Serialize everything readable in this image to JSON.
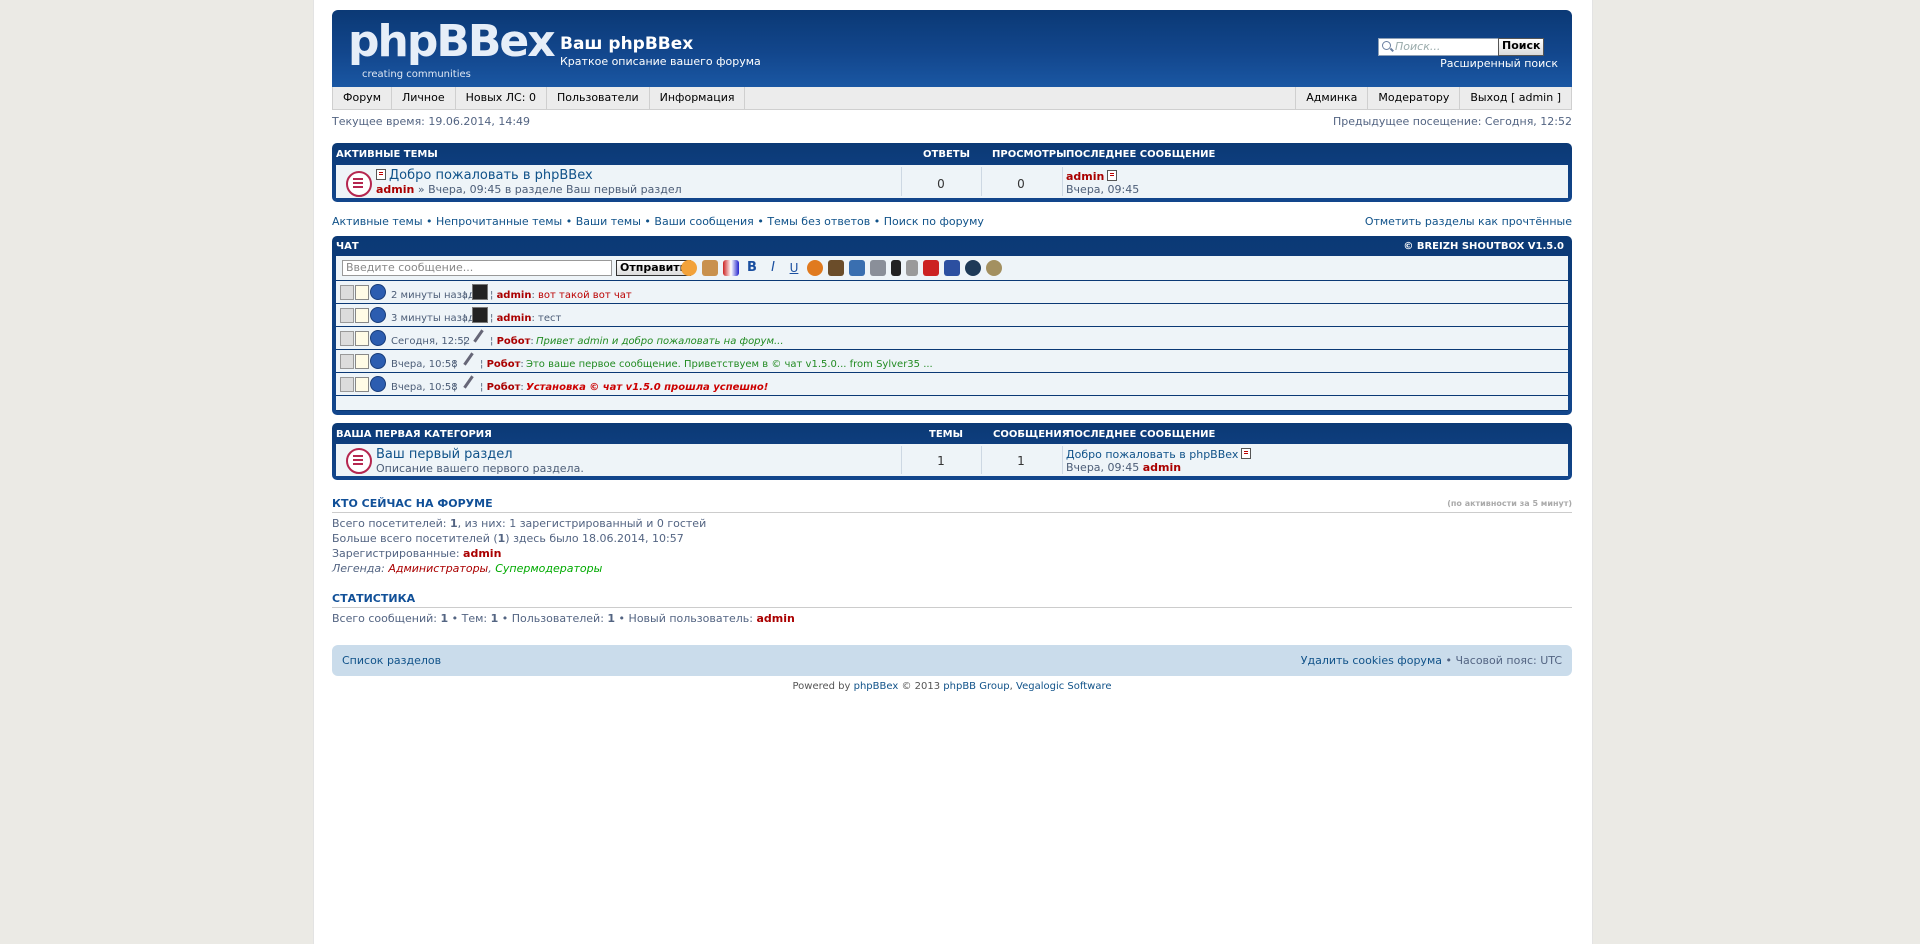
{
  "header": {
    "logo_text": "phpBBex",
    "logo_tagline": "creating communities",
    "site_title": "Ваш phpBBex",
    "site_description": "Краткое описание вашего форума",
    "search_placeholder": "Поиск...",
    "search_button": "Поиск",
    "advanced_search": "Расширенный поиск",
    "brand_color": "#12468c"
  },
  "navbar": {
    "left": [
      "Форум",
      "Личное",
      "Новых ЛС: 0",
      "Пользователи",
      "Информация"
    ],
    "right": [
      "Админка",
      "Модератору",
      "Выход [ admin ]"
    ]
  },
  "timebar": {
    "current_time": "Текущее время: 19.06.2014, 14:49",
    "last_visit": "Предыдущее посещение: Сегодня, 12:52"
  },
  "active_topics": {
    "title": "АКТИВНЫЕ ТЕМЫ",
    "col_replies": "ОТВЕТЫ",
    "col_views": "ПРОСМОТРЫ",
    "col_last": "ПОСЛЕДНЕЕ СООБЩЕНИЕ",
    "topic": {
      "title": "Добро пожаловать в phpBBex",
      "author": "admin",
      "meta": " » Вчера, 09:45 в разделе Ваш первый раздел",
      "replies": "0",
      "views": "0",
      "last_author": "admin",
      "last_time": "Вчера, 09:45"
    }
  },
  "quick_links": {
    "left": [
      "Активные темы",
      "Непрочитанные темы",
      "Ваши темы",
      "Ваши сообщения",
      "Темы без ответов",
      "Поиск по форуму"
    ],
    "right": "Отметить разделы как прочтённые"
  },
  "chat": {
    "title": "ЧАТ",
    "credit": "© BREIZH SHOUTBOX V1.5.0",
    "input_placeholder": "Введите сообщение...",
    "send_button": "Отправить",
    "messages": [
      {
        "time": "2 минуты назад",
        "user": "admin",
        "text": "вот такой вот чат"
      },
      {
        "time": "3 минуты назад",
        "user": "admin",
        "text": "тест"
      },
      {
        "time": "Сегодня, 12:52",
        "user": "Робот",
        "text": "Привет admin и добро пожаловать на форум..."
      },
      {
        "time": "Вчера, 10:58",
        "user": "Робот",
        "text": "Это ваше первое сообщение. Приветствуем в © чат v1.5.0... from Sylver35 ..."
      },
      {
        "time": "Вчера, 10:58",
        "user": "Робот",
        "text": "Установка © чат v1.5.0 прошла успешно!"
      }
    ]
  },
  "category": {
    "title": "ВАША ПЕРВАЯ КАТЕГОРИЯ",
    "col_topics": "ТЕМЫ",
    "col_posts": "СООБЩЕНИЯ",
    "col_last": "ПОСЛЕДНЕЕ СООБЩЕНИЕ",
    "forum": {
      "title": "Ваш первый раздел",
      "description": "Описание вашего первого раздела.",
      "topics": "1",
      "posts": "1",
      "last_topic": "Добро пожаловать в phpBBex",
      "last_time": "Вчера, 09:45",
      "last_author": "admin"
    }
  },
  "online": {
    "title": "КТО СЕЙЧАС НА ФОРУМЕ",
    "note": "(по активности за 5 минут)",
    "total_prefix": "Всего посетителей: ",
    "total_num": "1",
    "total_suffix": ", из них: 1 зарегистрированный и 0 гостей",
    "max_prefix": "Больше всего посетителей (",
    "max_num": "1",
    "max_suffix": ") здесь было 18.06.2014, 10:57",
    "registered_label": "Зарегистрированные: ",
    "registered_user": "admin",
    "legend_label": "Легенда: ",
    "legend_admins": "Администраторы",
    "legend_mods": "Супермодераторы"
  },
  "stats": {
    "title": "СТАТИСТИКА",
    "posts_label": "Всего сообщений: ",
    "posts": "1",
    "topics_label": " • Тем: ",
    "topics": "1",
    "users_label": " • Пользователей: ",
    "users": "1",
    "newest_label": " • Новый пользователь: ",
    "newest": "admin"
  },
  "footer": {
    "index_link": "Список разделов",
    "delete_cookies": "Удалить cookies форума",
    "timezone": "Часовой пояс: UTC",
    "powered_prefix": "Powered by ",
    "powered_phpbbex": "phpBBex",
    "powered_middle": " © 2013 ",
    "powered_phpbb": "phpBB Group",
    "powered_comma": ", ",
    "powered_vegalogic": "Vegalogic Software"
  }
}
